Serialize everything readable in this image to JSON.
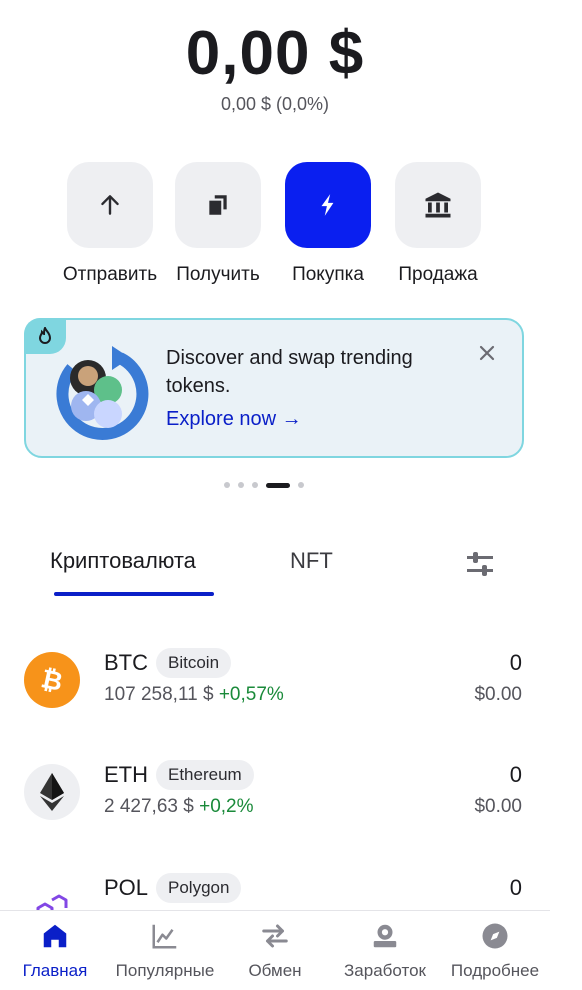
{
  "balance": {
    "value": "0,00 $",
    "change": "0,00 $ (0,0%)"
  },
  "actions": [
    {
      "label": "Отправить",
      "icon": "arrow-up-icon"
    },
    {
      "label": "Получить",
      "icon": "copy-stack-icon"
    },
    {
      "label": "Покупка",
      "icon": "lightning-icon",
      "primary": true
    },
    {
      "label": "Продажа",
      "icon": "bank-icon"
    }
  ],
  "banner": {
    "text": "Discover and swap trending tokens.",
    "cta": "Explore now →",
    "icon": "flame-icon"
  },
  "carousel": {
    "count": 5,
    "active_index": 3
  },
  "tabs": {
    "crypto": "Криптовалюта",
    "nft": "NFT",
    "active": "crypto"
  },
  "assets": [
    {
      "symbol": "BTC",
      "name": "Bitcoin",
      "price": "107 258,11 $",
      "change": "+0,57%",
      "amount": "0",
      "fiat": "$0.00",
      "color": "#f7931a"
    },
    {
      "symbol": "ETH",
      "name": "Ethereum",
      "price": "2 427,63 $",
      "change": "+0,2%",
      "amount": "0",
      "fiat": "$0.00",
      "color": "#343434"
    },
    {
      "symbol": "POL",
      "name": "Polygon",
      "price": "",
      "change": "",
      "amount": "0",
      "fiat": "",
      "color": "#8247e5"
    }
  ],
  "nav": [
    {
      "label": "Главная",
      "icon": "home-icon",
      "active": true
    },
    {
      "label": "Популярные",
      "icon": "chart-icon"
    },
    {
      "label": "Обмен",
      "icon": "swap-arrows-icon"
    },
    {
      "label": "Заработок",
      "icon": "earn-icon"
    },
    {
      "label": "Подробнее",
      "icon": "compass-icon"
    }
  ],
  "colors": {
    "accent": "#0a1fc8",
    "primary_button": "#0a1ff0",
    "positive": "#1a8a3a",
    "banner_border": "#7fd6e0"
  }
}
